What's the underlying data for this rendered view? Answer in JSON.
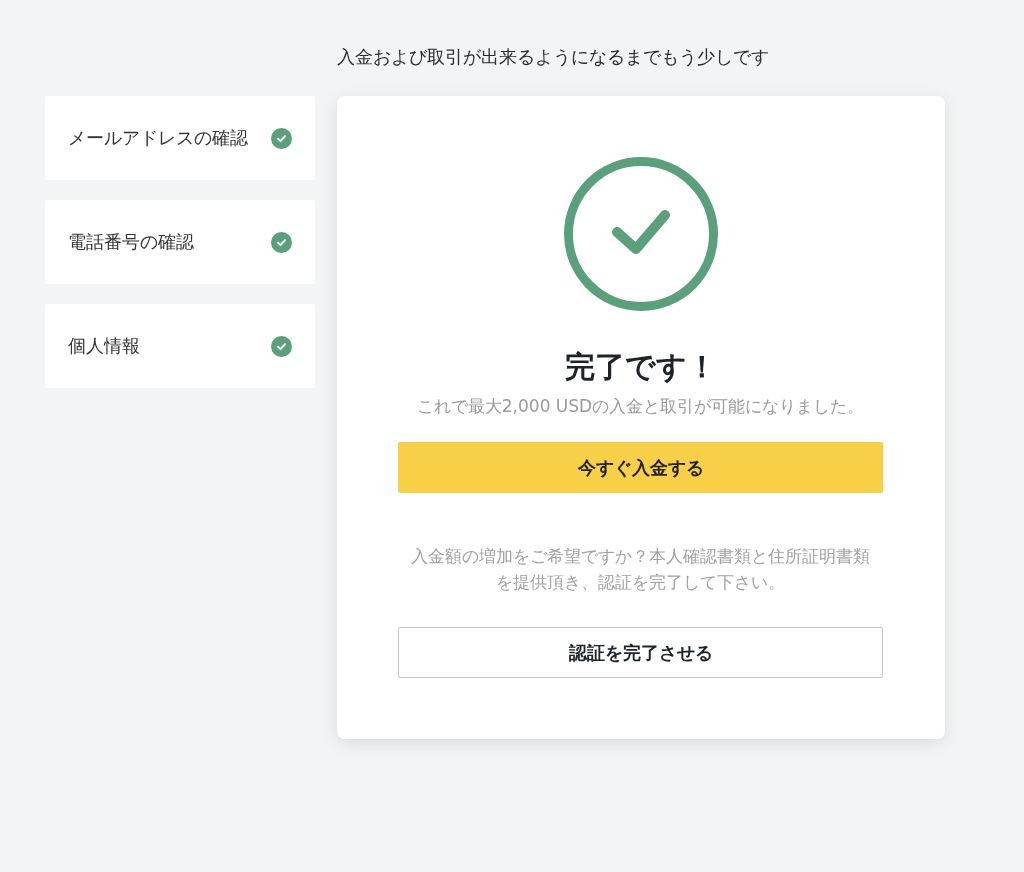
{
  "header": {
    "text": "入金および取引が出来るようになるまでもう少しです"
  },
  "steps": [
    {
      "label": "メールアドレスの確認",
      "completed": true
    },
    {
      "label": "電話番号の確認",
      "completed": true
    },
    {
      "label": "個人情報",
      "completed": true
    }
  ],
  "result": {
    "completed": true,
    "title": "完了です！",
    "subtitle": "これで最大2,000 USDの入金と取引が可能になりました。",
    "primary_button": "今すぐ入金する",
    "note": "入金額の増加をご希望ですか？本人確認書類と住所証明書類を提供頂き、認証を完了して下さい。",
    "secondary_button": "認証を完了させる"
  }
}
